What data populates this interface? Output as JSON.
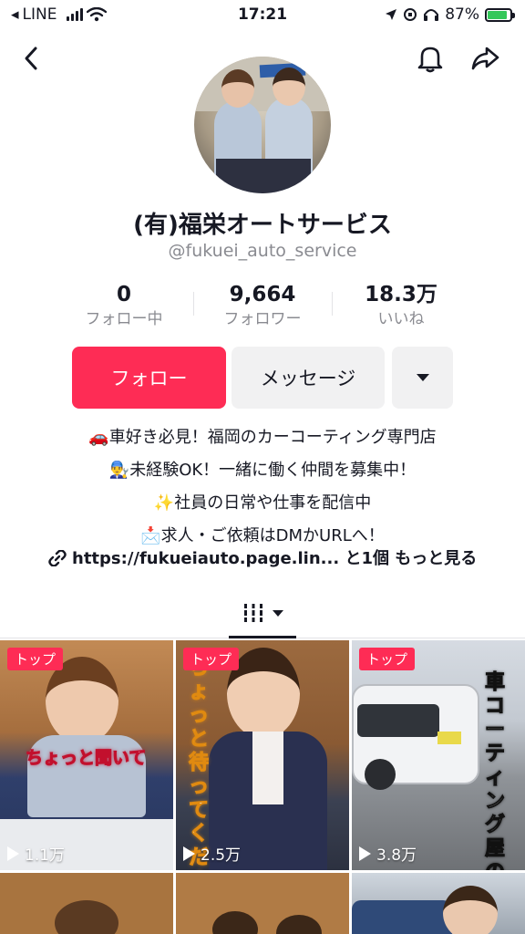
{
  "status_bar": {
    "carrier": "LINE",
    "time": "17:21",
    "battery": "87%",
    "battery_level": 0.87,
    "colors": {
      "battery_fill": "#34c759"
    }
  },
  "nav": {
    "back_icon": "chevron-left-icon",
    "bell_icon": "bell-icon",
    "share_icon": "share-arrow-icon"
  },
  "profile": {
    "display_name": "(有)福栄オートサービス",
    "handle": "@fukuei_auto_service"
  },
  "stats": [
    {
      "value": "0",
      "label": "フォロー中"
    },
    {
      "value": "9,664",
      "label": "フォロワー"
    },
    {
      "value": "18.3万",
      "label": "いいね"
    }
  ],
  "actions": {
    "follow_label": "フォロー",
    "message_label": "メッセージ",
    "more_icon": "caret-down-icon",
    "colors": {
      "follow": "#fe2c55",
      "secondary": "#f1f1f2"
    }
  },
  "bio": {
    "lines": [
      "🚗車好き必見！福岡のカーコーティング専門店",
      "👨‍🔧未経験OK！一緒に働く仲間を募集中！",
      "✨社員の日常や仕事を配信中",
      "📩求人・ご依頼はDMかURLへ！"
    ],
    "link_icon": "link-icon",
    "link_text": "https://fukueiauto.page.lin...",
    "link_extra": "と1個",
    "more_label": "もっと見る"
  },
  "tabs": {
    "active_icon": "grid-icon",
    "dropdown_icon": "caret-down-icon"
  },
  "videos": [
    {
      "badge": "トップ",
      "views": "1.1万",
      "caption": "ちょっと聞いて"
    },
    {
      "badge": "トップ",
      "views": "2.5万",
      "caption": "ちょっと待ってくださ"
    },
    {
      "badge": "トップ",
      "views": "3.8万",
      "caption": "車コーティング屋の"
    }
  ]
}
